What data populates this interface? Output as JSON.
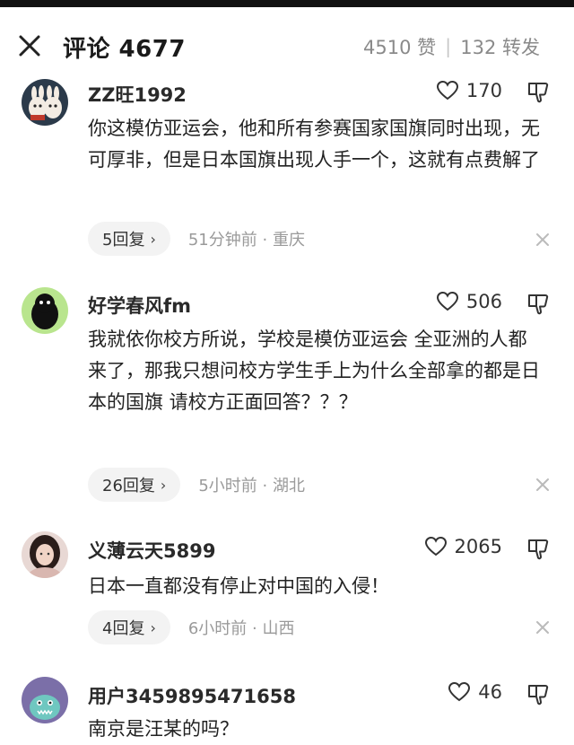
{
  "header": {
    "title": "评论 4677",
    "likes_text": "4510 赞",
    "separator": "|",
    "shares_text": "132 转发"
  },
  "comments": [
    {
      "username": "ZZ旺1992",
      "likes": "170",
      "text": "你这模仿亚运会，他和所有参赛国家国旗同时出现，无可厚非，但是日本国旗出现人手一个，这就有点费解了",
      "replies": "5回复",
      "time": "51分钟前",
      "dot": "·",
      "location": "重庆"
    },
    {
      "username": "好学春风fm",
      "likes": "506",
      "text": "我就依你校方所说，学校是模仿亚运会 全亚洲的人都来了，那我只想问校方学生手上为什么全部拿的都是日本的国旗 请校方正面回答？？？",
      "replies": "26回复",
      "time": "5小时前",
      "dot": "·",
      "location": "湖北"
    },
    {
      "username": "义薄云天5899",
      "likes": "2065",
      "text": "日本一直都没有停止对中国的入侵！",
      "replies": "4回复",
      "time": "6小时前",
      "dot": "·",
      "location": "山西"
    },
    {
      "username": "用户3459895471658",
      "likes": "46",
      "text": "南京是汪某的吗？"
    }
  ],
  "colors": {
    "text": "#222222",
    "muted": "#9a9a9a",
    "pill_bg": "#f3f3f3"
  }
}
